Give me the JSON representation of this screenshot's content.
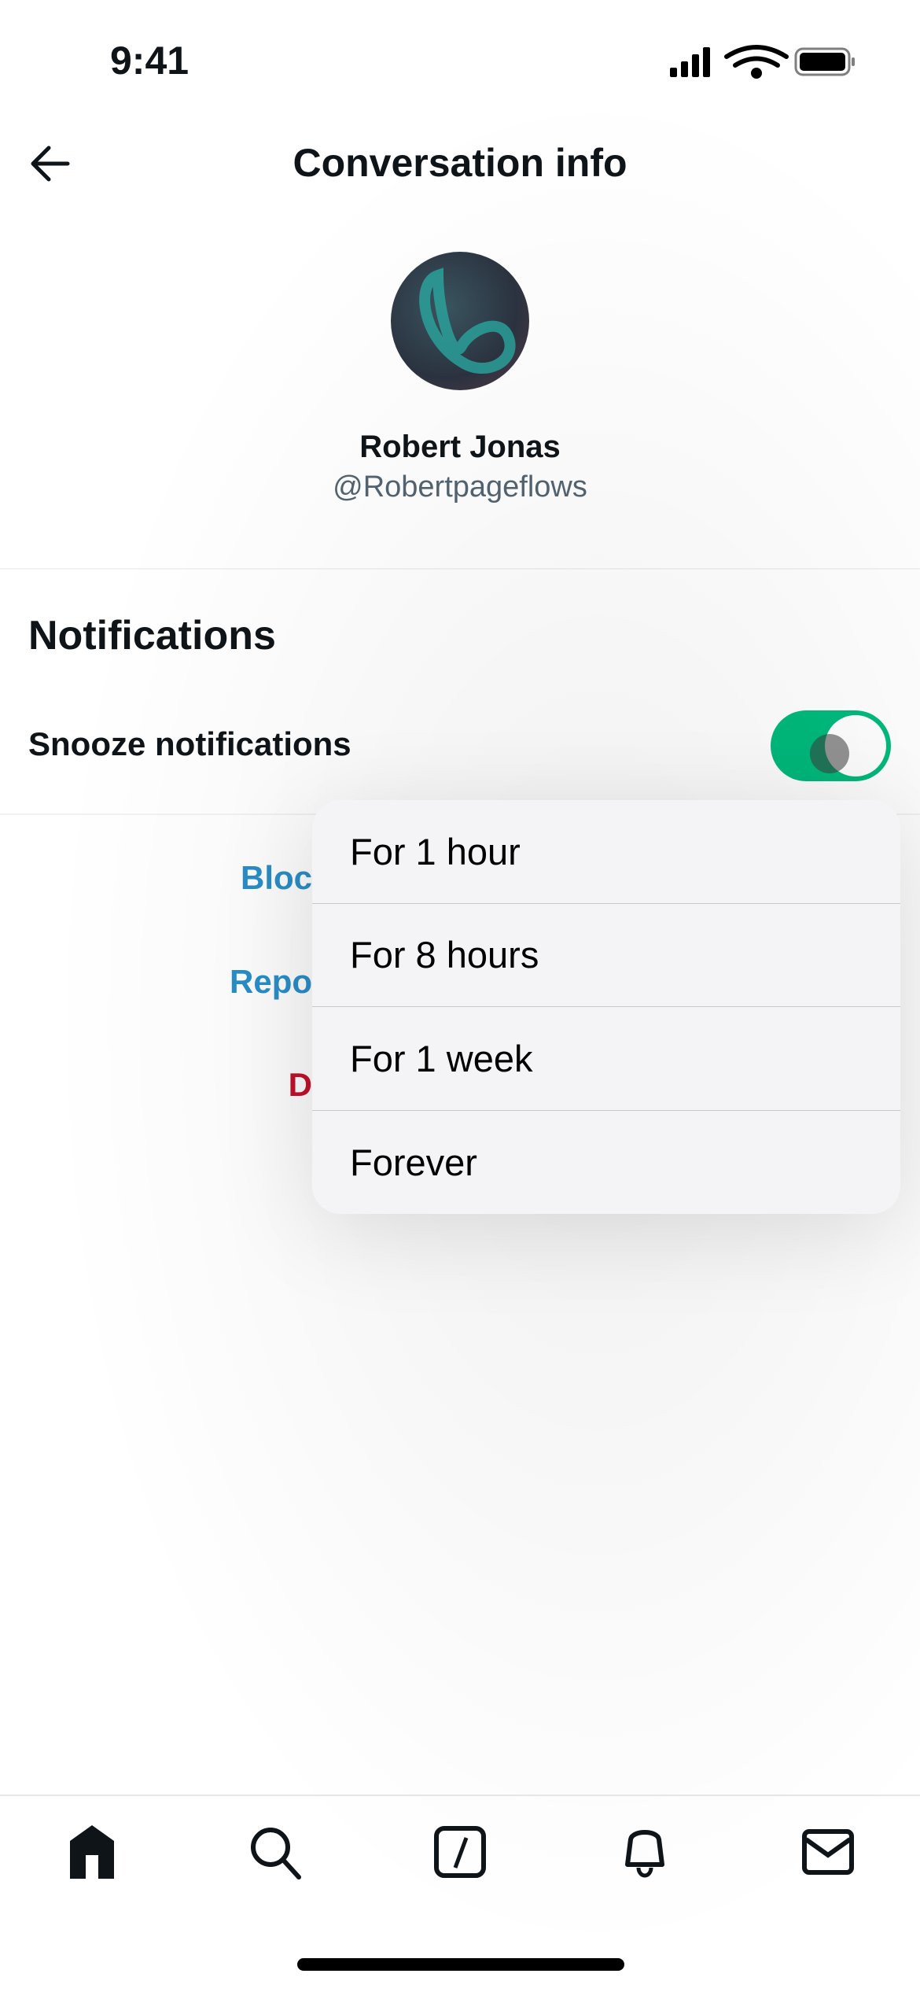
{
  "status_bar": {
    "time": "9:41"
  },
  "header": {
    "title": "Conversation info"
  },
  "profile": {
    "name": "Robert Jonas",
    "handle": "@Robertpageflows"
  },
  "notifications": {
    "heading": "Notifications",
    "snooze_label": "Snooze notifications",
    "snooze_on": true
  },
  "actions": {
    "block_partial": "Bloc",
    "report_partial": "Repo",
    "delete_partial": "D"
  },
  "snooze_menu": {
    "options": [
      "For 1 hour",
      "For 8 hours",
      "For 1 week",
      "Forever"
    ]
  },
  "tab_bar": {
    "icons": [
      "home-icon",
      "search-icon",
      "compose-icon",
      "bell-icon",
      "mail-icon"
    ]
  },
  "colors": {
    "accent_blue": "#1d9bf0",
    "toggle_green": "#00ba7c",
    "danger_red": "#c4102a"
  }
}
